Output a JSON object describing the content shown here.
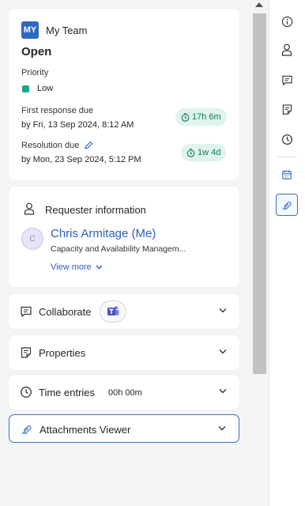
{
  "ticket": {
    "team_badge": "MY",
    "team_name": "My Team",
    "status": "Open",
    "priority_label": "Priority",
    "priority_value": "Low",
    "priority_color": "#1aa88c",
    "first_response_label": "First response due",
    "first_response_date": "by Fri, 13 Sep 2024, 8:12 AM",
    "first_response_remaining": "17h 6m",
    "resolution_label": "Resolution due",
    "resolution_date": "by Mon, 23 Sep 2024, 5:12 PM",
    "resolution_remaining": "1w 4d"
  },
  "requester": {
    "section_title": "Requester information",
    "avatar_initial": "C",
    "name": "Chris Armitage (Me)",
    "department": "Capacity and Availability Managem...",
    "view_more": "View more"
  },
  "sections": {
    "collaborate": "Collaborate",
    "properties": "Properties",
    "time_entries": "Time entries",
    "time_value": "00h 00m",
    "attachments": "Attachments Viewer"
  },
  "rail_icons": [
    "info-icon",
    "person-icon",
    "comment-icon",
    "note-icon",
    "clock-icon",
    "calendar-icon",
    "attachment-icon"
  ],
  "colors": {
    "accent": "#2d5ebd",
    "pill_bg": "#dff4ea",
    "pill_text": "#127a58"
  }
}
